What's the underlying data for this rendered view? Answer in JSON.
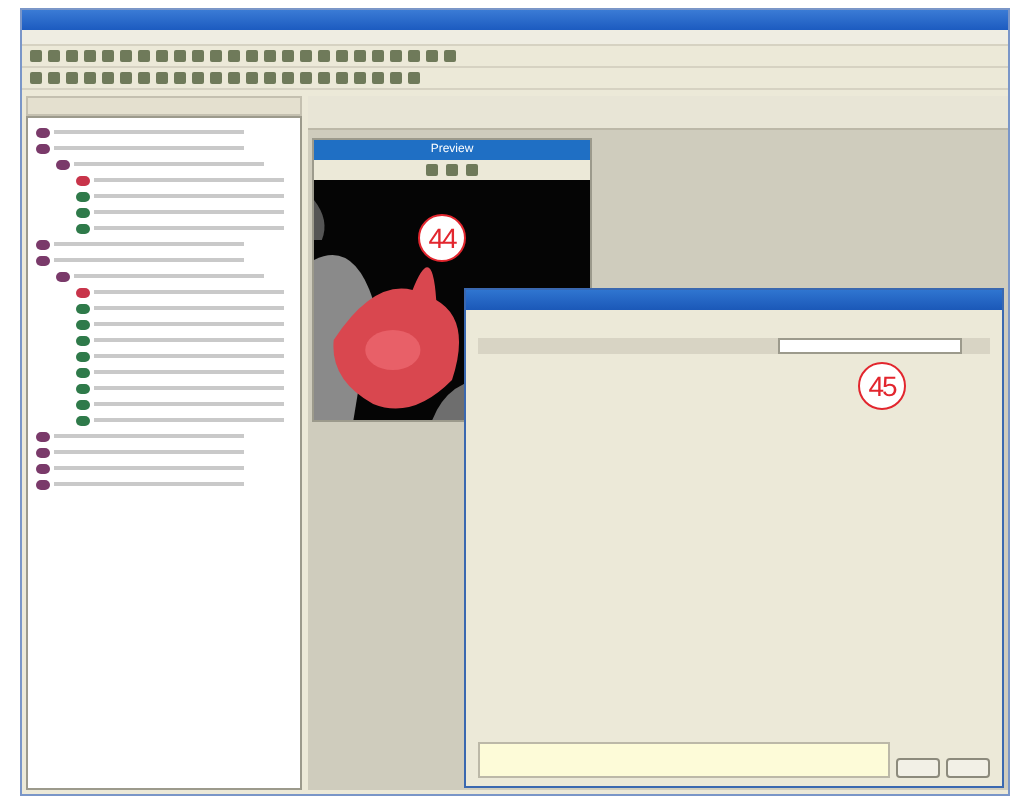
{
  "tree": {
    "items": [
      {
        "color": "#7a3a6a"
      },
      {
        "color": "#7a3a6a",
        "children": [
          {
            "color": "#7a3a6a",
            "children": [
              {
                "color": "#c8344a"
              },
              {
                "color": "#2f7a4a"
              },
              {
                "color": "#2f7a4a"
              },
              {
                "color": "#2f7a4a"
              }
            ]
          }
        ]
      },
      {
        "color": "#7a3a6a"
      },
      {
        "color": "#7a3a6a",
        "children": [
          {
            "color": "#7a3a6a",
            "children": [
              {
                "color": "#c8344a"
              },
              {
                "color": "#2f7a4a"
              },
              {
                "color": "#2f7a4a"
              },
              {
                "color": "#2f7a4a"
              },
              {
                "color": "#2f7a4a"
              },
              {
                "color": "#2f7a4a"
              },
              {
                "color": "#2f7a4a"
              },
              {
                "color": "#2f7a4a"
              },
              {
                "color": "#2f7a4a"
              }
            ]
          }
        ]
      },
      {
        "color": "#7a3a6a"
      },
      {
        "color": "#7a3a6a"
      },
      {
        "color": "#7a3a6a"
      },
      {
        "color": "#7a3a6a"
      }
    ]
  },
  "preview": {
    "title": "Preview"
  },
  "callouts": [
    {
      "label": "44"
    },
    {
      "label": "45"
    }
  ]
}
